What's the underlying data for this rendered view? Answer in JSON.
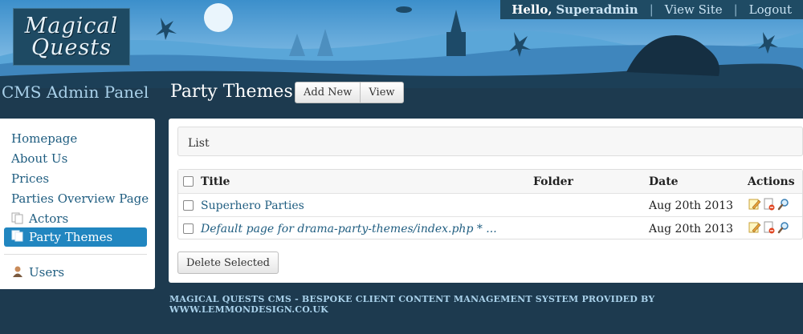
{
  "brand": {
    "logo_line1": "Magical",
    "logo_line2": "Quests"
  },
  "topbar": {
    "greeting": "Hello,",
    "username": "Superadmin",
    "separator": "|",
    "view_site": "View Site",
    "logout": "Logout"
  },
  "header": {
    "panel_title": "CMS Admin Panel",
    "page_title": "Party Themes",
    "add_new": "Add New",
    "view": "View"
  },
  "sidebar": {
    "items": [
      {
        "label": "Homepage"
      },
      {
        "label": "About Us"
      },
      {
        "label": "Prices"
      },
      {
        "label": "Parties Overview Page"
      },
      {
        "label": "Actors",
        "icon": "pages-icon"
      },
      {
        "label": "Party Themes",
        "icon": "pages-icon",
        "active": true
      }
    ],
    "users": {
      "label": "Users",
      "icon": "user-icon"
    }
  },
  "main": {
    "list_label": "List",
    "table": {
      "headers": {
        "title": "Title",
        "folder": "Folder",
        "date": "Date",
        "actions": "Actions"
      },
      "rows": [
        {
          "title": "Superhero Parties",
          "folder": "",
          "date": "Aug 20th 2013"
        },
        {
          "title": "Default page for drama-party-themes/index.php * ...",
          "folder": "",
          "date": "Aug 20th 2013"
        }
      ]
    },
    "delete_selected": "Delete Selected"
  },
  "footer": {
    "text": "MAGICAL QUESTS CMS - BESPOKE CLIENT CONTENT MANAGEMENT SYSTEM PROVIDED BY WWW.LEMMONDESIGN.CO.UK"
  },
  "colors": {
    "background": "#1d3a4f",
    "sky": "#4f9fd6",
    "accent": "#2186c0",
    "link": "#1f5d80"
  }
}
